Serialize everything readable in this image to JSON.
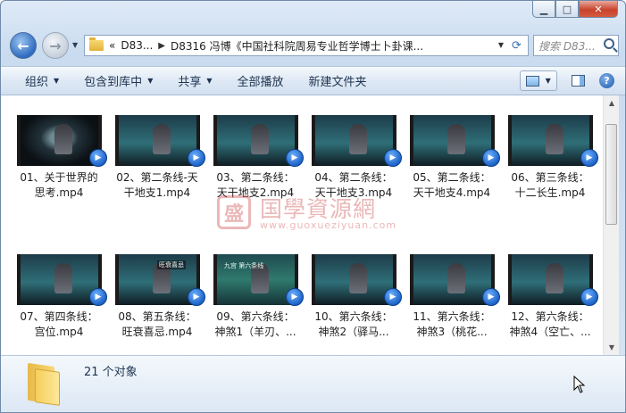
{
  "window": {
    "caption": {
      "minimize_icon": "minimize-icon",
      "maximize_icon": "maximize-icon",
      "close_icon": "close-icon"
    }
  },
  "address": {
    "crumbs": [
      "D83...",
      "D8316 冯博《中国社科院周易专业哲学博士卜卦课..."
    ],
    "overflow": "«",
    "search_placeholder": "搜索 D83..."
  },
  "toolbar": {
    "organize": "组织",
    "include_in_library": "包含到库中",
    "share": "共享",
    "play_all": "全部播放",
    "new_folder": "新建文件夹"
  },
  "files": [
    {
      "line1": "01、关于世界的",
      "line2": "思考.mp4",
      "thumb": "dark",
      "thumb_text": ""
    },
    {
      "line1": "02、第二条线-天",
      "line2": "干地支1.mp4",
      "thumb": "scene",
      "thumb_text": ""
    },
    {
      "line1": "03、第二条线：",
      "line2": "天干地支2.mp4",
      "thumb": "scene",
      "thumb_text": ""
    },
    {
      "line1": "04、第二条线：",
      "line2": "天干地支3.mp4",
      "thumb": "scene",
      "thumb_text": ""
    },
    {
      "line1": "05、第二条线：",
      "line2": "天干地支4.mp4",
      "thumb": "scene",
      "thumb_text": ""
    },
    {
      "line1": "06、第三条线：",
      "line2": "十二长生.mp4",
      "thumb": "scene",
      "thumb_text": ""
    },
    {
      "line1": "07、第四条线：",
      "line2": "宫位.mp4",
      "thumb": "scene",
      "thumb_text": ""
    },
    {
      "line1": "08、第五条线：",
      "line2": "旺衰喜忌.mp4",
      "thumb": "scene",
      "thumb_text": "旺衰喜忌"
    },
    {
      "line1": "09、第六条线：",
      "line2": "神煞1（羊刃、...",
      "thumb": "green",
      "thumb_text": "九宫 第六条线"
    },
    {
      "line1": "10、第六条线：",
      "line2": "神煞2（驿马...",
      "thumb": "scene",
      "thumb_text": ""
    },
    {
      "line1": "11、第六条线：",
      "line2": "神煞3（桃花...",
      "thumb": "scene",
      "thumb_text": ""
    },
    {
      "line1": "12、第六条线：",
      "line2": "神煞4（空亡、...",
      "thumb": "scene",
      "thumb_text": ""
    }
  ],
  "watermark": {
    "seal": "盛",
    "text": "国學資源網",
    "url": "www.guoxueziyuan.com"
  },
  "status": {
    "count_text": "21 个对象"
  }
}
